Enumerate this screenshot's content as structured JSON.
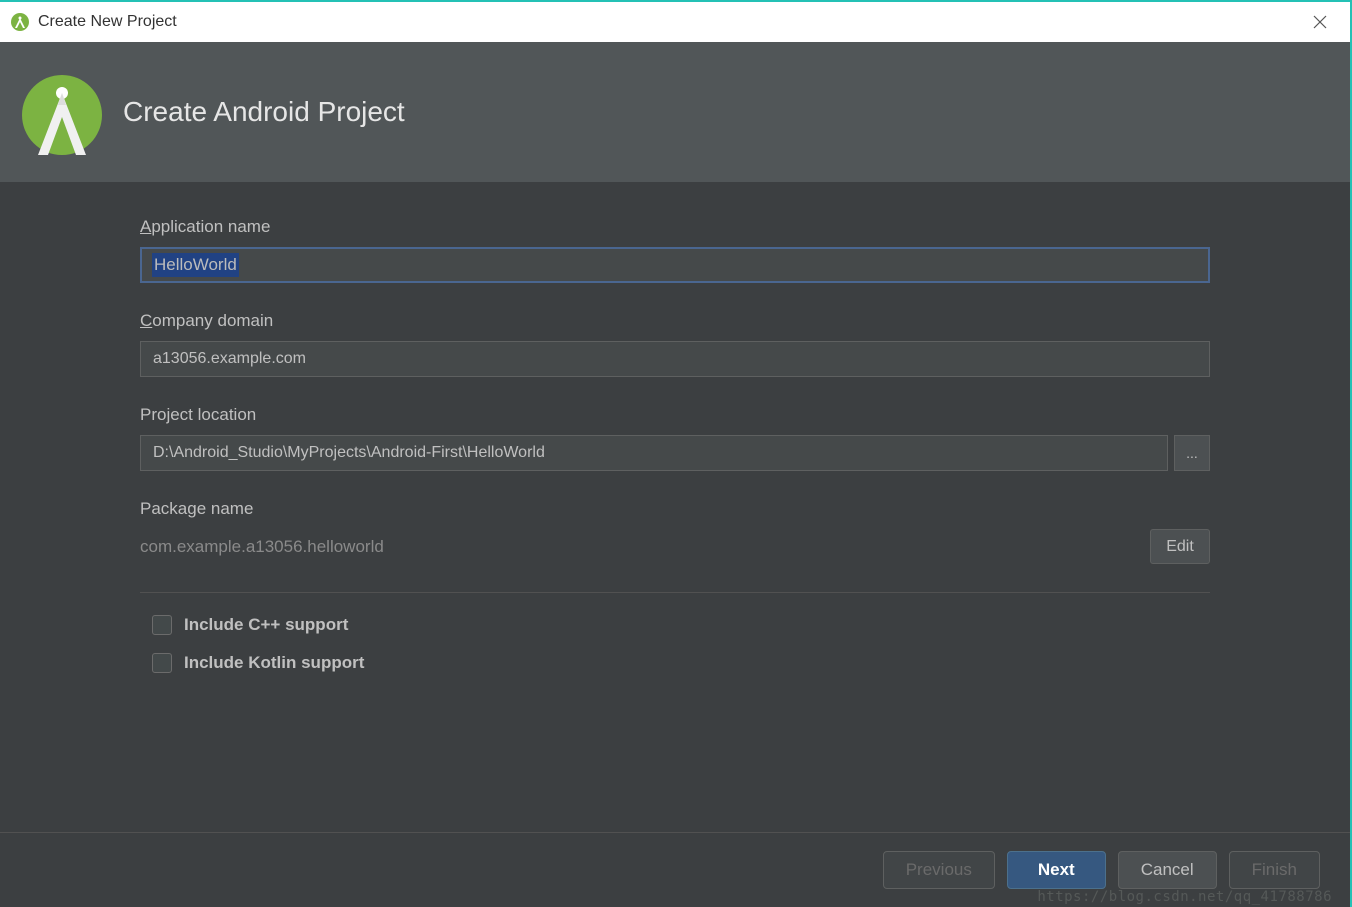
{
  "titlebar": {
    "title": "Create New Project"
  },
  "header": {
    "title": "Create Android Project"
  },
  "form": {
    "app_name_label": "pplication name",
    "app_name_prefix": "A",
    "app_name_value": "HelloWorld",
    "company_domain_label": "ompany domain",
    "company_domain_prefix": "C",
    "company_domain_value": "a13056.example.com",
    "project_location_label": "Project location",
    "project_location_value": "D:\\Android_Studio\\MyProjects\\Android-First\\HelloWorld",
    "browse_label": "...",
    "package_name_label": "Package name",
    "package_name_value": "com.example.a13056.helloworld",
    "edit_label": "Edit",
    "cpp_support_label": "Include C++ support",
    "kotlin_support_label": "Include Kotlin support"
  },
  "footer": {
    "previous": "Previous",
    "next": "Next",
    "cancel": "Cancel",
    "finish": "Finish"
  },
  "watermark": "https://blog.csdn.net/qq_41788786"
}
